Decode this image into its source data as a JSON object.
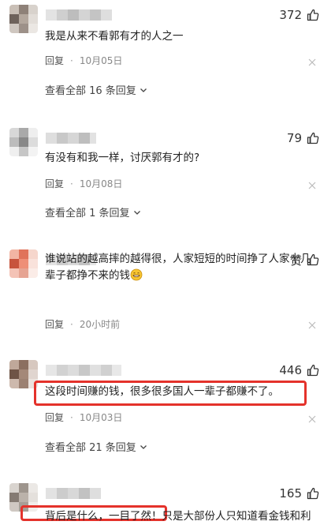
{
  "comments": [
    {
      "likes": "372",
      "text": "我是从来不看郭有才的人之一",
      "reply_label": "回复",
      "time": "10月05日",
      "replies_label": "查看全部 16 条回复"
    },
    {
      "likes": "79",
      "text": "有没有和我一样，讨厌郭有才的?",
      "reply_label": "回复",
      "time": "10月08日",
      "replies_label": "查看全部 1 条回复"
    },
    {
      "likes": "赞",
      "text_line1": "谁说站的越高摔的越得很，人家短短的时间挣了人家十几",
      "text_line2": "辈子都挣不来的钱",
      "reply_label": "回复",
      "time": "20小时前"
    },
    {
      "likes": "446",
      "text": "这段时间赚的钱，很多很多国人一辈子都赚不了。",
      "reply_label": "回复",
      "time": "10月03日",
      "replies_label": "查看全部 21 条回复"
    },
    {
      "likes": "165",
      "text": "背后是什么，一目了然！只是大部份人只知道看金钱和利"
    }
  ],
  "colors": {
    "highlight": "#e4322b",
    "meta_text": "#888888"
  },
  "icons": {
    "like": "thumbs-up-icon",
    "close": "close-icon",
    "chevron": "chevron-down-icon",
    "emoji": "grinning-face-icon"
  }
}
